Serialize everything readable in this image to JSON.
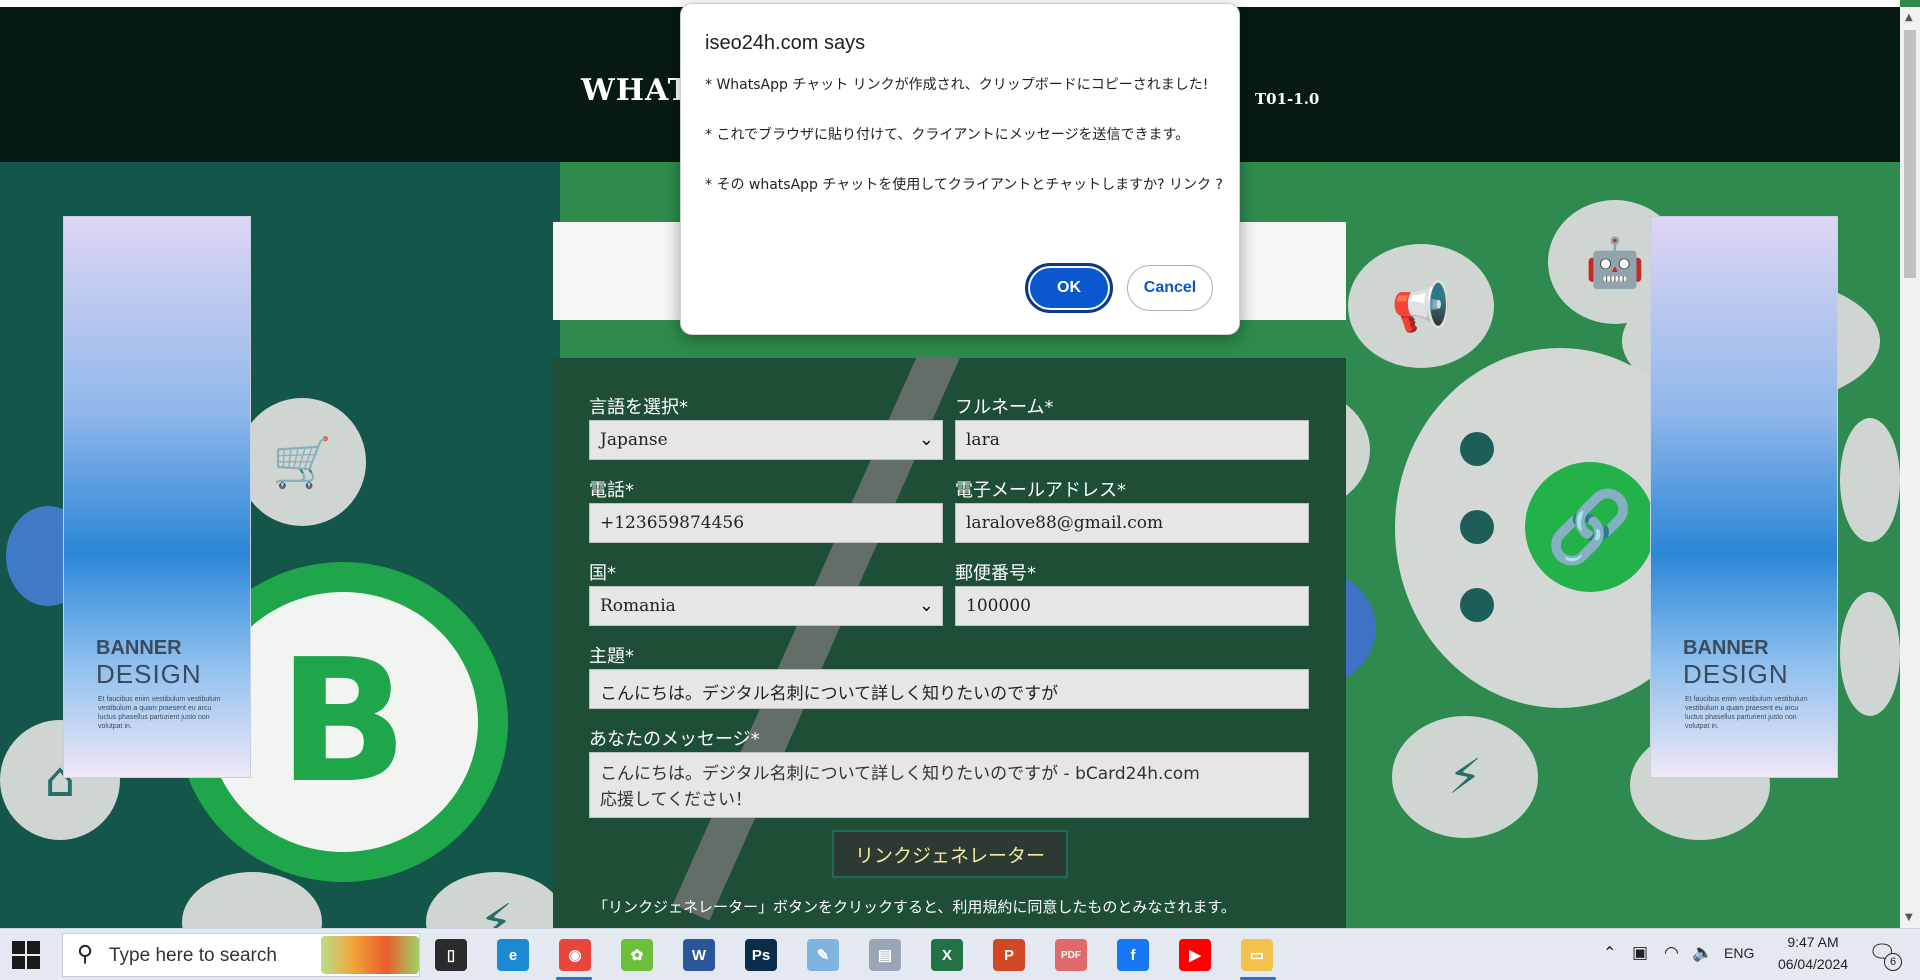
{
  "page": {
    "header_title": "WHAT",
    "header_version": "T01-1.0"
  },
  "form": {
    "language_label": "言語を選択*",
    "language_value": "Japanse",
    "fullname_label": "フルネーム*",
    "fullname_value": "lara",
    "phone_label": "電話*",
    "phone_value": "+123659874456",
    "email_label": "電子メールアドレス*",
    "email_value": "laralove88@gmail.com",
    "country_label": "国*",
    "country_value": "Romania",
    "postal_label": "郵便番号*",
    "postal_value": "100000",
    "subject_label": "主題*",
    "subject_value": "こんにちは。デジタル名刺について詳しく知りたいのですが",
    "message_label": "あなたのメッセージ*",
    "message_line1": "こんにちは。デジタル名刺について詳しく知りたいのですが - bCard24h.com",
    "message_line2": "応援してください！",
    "generate_button": "リンクジェネレーター",
    "terms_text": "「リンクジェネレーター」ボタンをクリックすると、利用規約に同意したものとみなされます。"
  },
  "banners": {
    "title": "BANNER",
    "subtitle": "DESIGN",
    "small_text": "Et faucibus enim vestibulum vestibulum vestibulum a quam praesent eu arcu luctus phasellus parturient justo non volutpat in."
  },
  "dialog": {
    "title": "iseo24h.com says",
    "line1": "* WhatsApp チャット リンクが作成され、クリップボードにコピーされました!",
    "line2": "* これでブラウザに貼り付けて、クライアントにメッセージを送信できます。",
    "line3": "* その whatsApp チャットを使用してクライアントとチャットしますか? リンク ?",
    "ok_label": "OK",
    "cancel_label": "Cancel"
  },
  "taskbar": {
    "search_placeholder": "Type here to search",
    "apps": [
      {
        "name": "task-view",
        "color": "#2b2b2b",
        "glyph": "▯"
      },
      {
        "name": "edge",
        "color": "#1b8ad3",
        "glyph": "e"
      },
      {
        "name": "chrome",
        "color": "#e8453c",
        "glyph": "◉"
      },
      {
        "name": "app-green",
        "color": "#6bbf3b",
        "glyph": "✿"
      },
      {
        "name": "word",
        "color": "#2b579a",
        "glyph": "W"
      },
      {
        "name": "photoshop",
        "color": "#0c2d4a",
        "glyph": "Ps"
      },
      {
        "name": "paint",
        "color": "#7fb3e0",
        "glyph": "✎"
      },
      {
        "name": "notepad",
        "color": "#9aa6b8",
        "glyph": "▤"
      },
      {
        "name": "excel",
        "color": "#217346",
        "glyph": "X"
      },
      {
        "name": "powerpoint",
        "color": "#d24726",
        "glyph": "P"
      },
      {
        "name": "pdf",
        "color": "#e06a6a",
        "glyph": "PDF"
      },
      {
        "name": "facebook",
        "color": "#1877f2",
        "glyph": "f"
      },
      {
        "name": "youtube",
        "color": "#ff0000",
        "glyph": "▶"
      },
      {
        "name": "file-explorer",
        "color": "#f2c14e",
        "glyph": "▭"
      }
    ],
    "language": "ENG",
    "time": "9:47 AM",
    "date": "06/04/2024",
    "notification_count": "6"
  },
  "colors": {
    "header_bg": "#061a12",
    "panel_bg": "#1e4e36",
    "accent_green": "#1fa64a",
    "ok_blue": "#0b57d0"
  }
}
